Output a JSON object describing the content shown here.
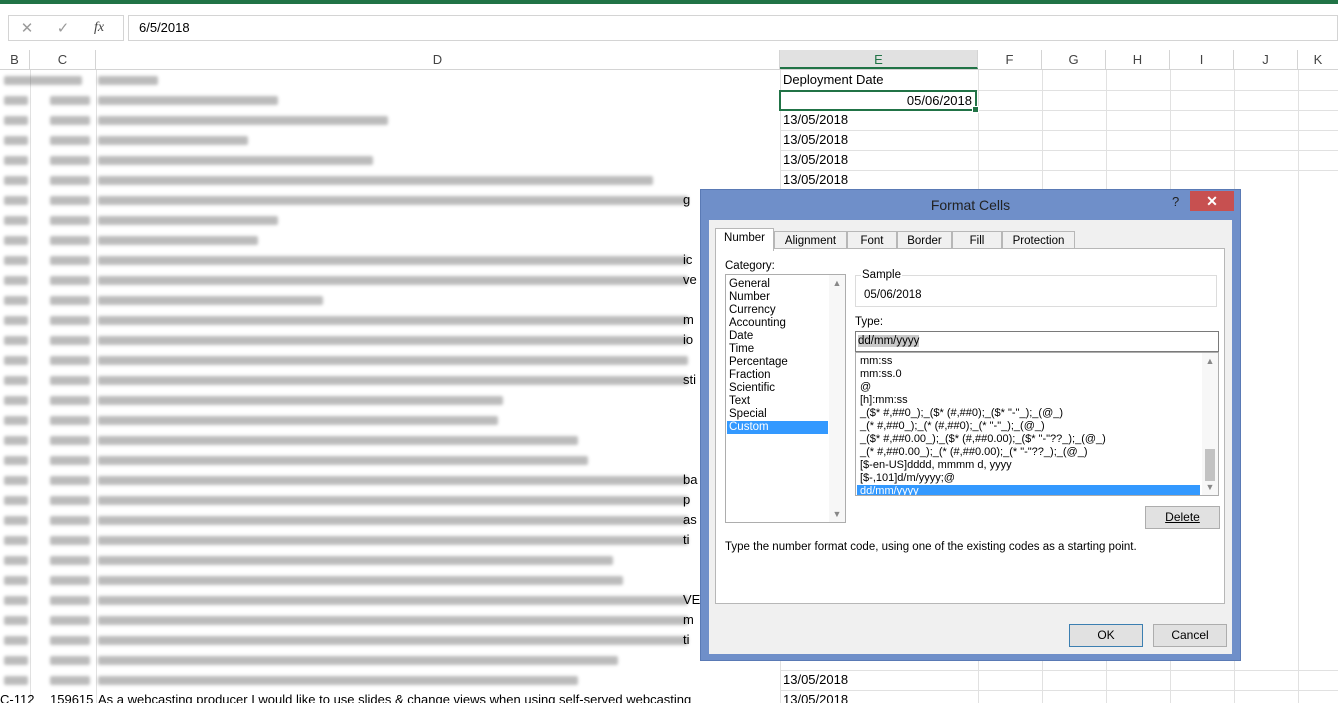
{
  "formula_bar": {
    "cancel_glyph": "✕",
    "enter_glyph": "✓",
    "fx_label": "fx",
    "value": "6/5/2018"
  },
  "columns": [
    "B",
    "C",
    "D",
    "E",
    "F",
    "G",
    "H",
    "I",
    "J",
    "K"
  ],
  "selected_column": "E",
  "sheet": {
    "e_header": "Deployment Date",
    "active_cell_value": "05/06/2018",
    "e_values": [
      "13/05/2018",
      "13/05/2018",
      "13/05/2018",
      "13/05/2018",
      "13/05/2018",
      "13/05/2018",
      "13/05/2018"
    ],
    "last_row": {
      "b": "C-112",
      "c": "159615",
      "d": "As a webcasting producer I would like to use slides & change views when using self-served webcasting"
    },
    "partial_right_texts": [
      "g",
      "ic",
      "ve",
      "m",
      "io",
      "sti",
      "ba",
      "p",
      "as",
      "ti",
      "VE",
      "m",
      "ti"
    ]
  },
  "dialog": {
    "title": "Format Cells",
    "help_glyph": "?",
    "close_glyph": "✕",
    "tabs": [
      "Number",
      "Alignment",
      "Font",
      "Border",
      "Fill",
      "Protection"
    ],
    "active_tab": "Number",
    "category_label": "Category:",
    "categories": [
      "General",
      "Number",
      "Currency",
      "Accounting",
      "Date",
      "Time",
      "Percentage",
      "Fraction",
      "Scientific",
      "Text",
      "Special",
      "Custom"
    ],
    "selected_category": "Custom",
    "sample_label": "Sample",
    "sample_value": "05/06/2018",
    "type_label": "Type:",
    "type_value": "dd/mm/yyyy",
    "type_list": [
      "mm:ss",
      "mm:ss.0",
      "@",
      "[h]:mm:ss",
      "_($* #,##0_);_($* (#,##0);_($* \"-\"_);_(@_)",
      "_(* #,##0_);_(* (#,##0);_(* \"-\"_);_(@_)",
      "_($* #,##0.00_);_($* (#,##0.00);_($* \"-\"??_);_(@_)",
      "_(* #,##0.00_);_(* (#,##0.00);_(* \"-\"??_);_(@_)",
      "[$-en-US]dddd, mmmm d, yyyy",
      "[$-,101]d/m/yyyy;@",
      "dd/mm/yyyy"
    ],
    "selected_type": "dd/mm/yyyy",
    "delete_label": "Delete",
    "hint": "Type the number format code, using one of the existing codes as a starting point.",
    "ok_label": "OK",
    "cancel_label": "Cancel"
  }
}
